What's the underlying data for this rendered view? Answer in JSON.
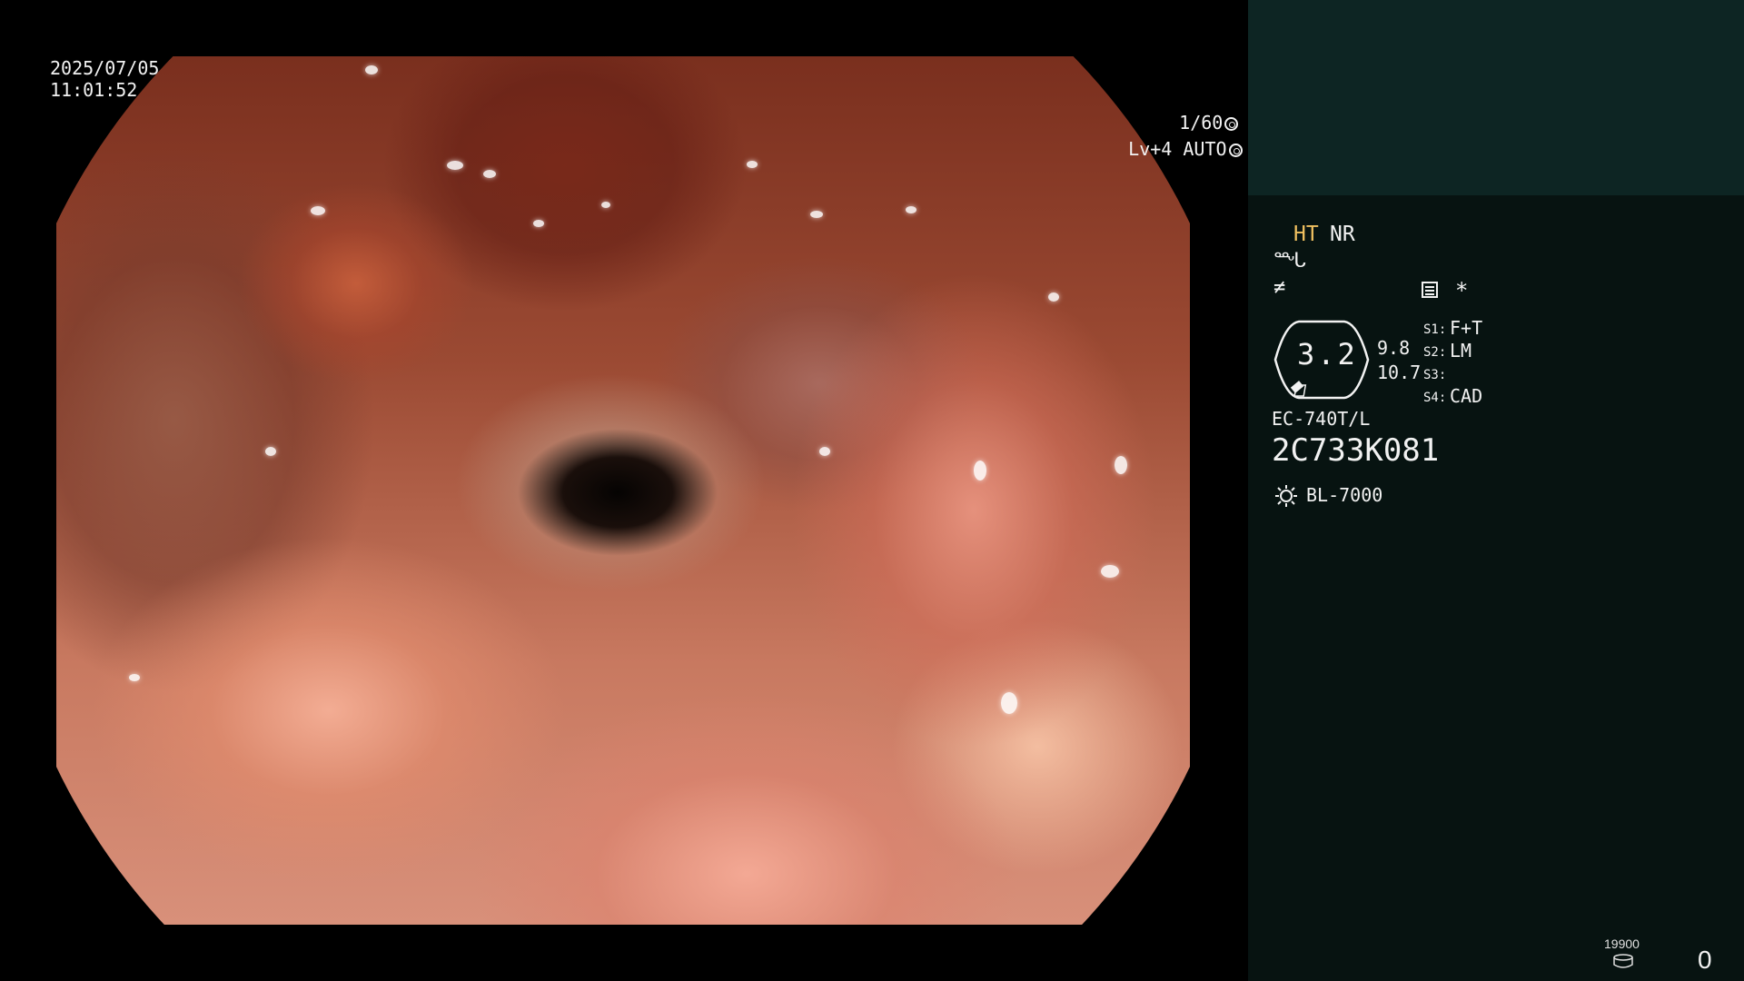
{
  "overlay": {
    "date": "2025/07/05",
    "time": "11:01:52",
    "shutter": "1/60",
    "level": "Lv+4 AUTO"
  },
  "panel": {
    "ht": "HT",
    "nr": "NR",
    "symbol_1": "ᙵ",
    "symbol_2": "≠",
    "asterisk": "*",
    "zoom": "3.2",
    "value_a": "9.8",
    "value_b": "10.7",
    "s1_label": "S1:",
    "s1_value": "F+T",
    "s2_label": "S2:",
    "s2_value": "LM",
    "s3_label": "S3:",
    "s3_value": "",
    "s4_label": "S4:",
    "s4_value": "CAD",
    "model": "EC-740T/L",
    "serial": "2C733K081",
    "light": "BL-7000",
    "counter": "19900",
    "zero": "0"
  },
  "colors": {
    "ht_accent": "#f0c060",
    "panel_top": "#0d2523",
    "panel_bg": "#071311"
  },
  "icons": [
    "shutter-icon",
    "auto-iris-icon",
    "menu-icon",
    "scale-icon",
    "light-icon",
    "memory-icon"
  ]
}
